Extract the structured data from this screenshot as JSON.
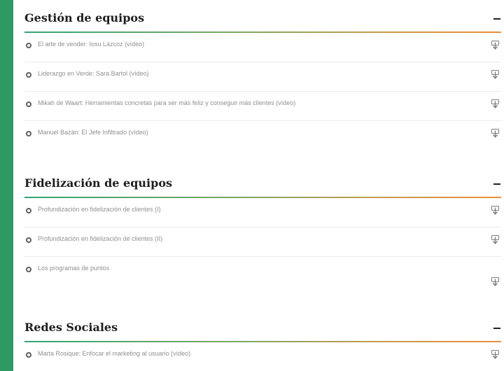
{
  "sections": [
    {
      "title": "Gestión de equipos",
      "lessons": [
        "El arte de vender: Iosu Lázcoz (vídeo)",
        "Liderazgo en Verde: Sara Bartol (vídeo)",
        "Mikah de Waart: Herramientas concretas para ser más feliz y conseguir más clientes (vídeo)",
        "Manuel Bazán: El Jefe Infiltrado (vídeo)"
      ]
    },
    {
      "title": "Fidelización de equipos",
      "lessons": [
        "Profundización en fidelización de clientes (I)",
        "Profundización en fidelización de clientes (II)",
        "Los programas de puntos"
      ]
    },
    {
      "title": "Redes Sociales",
      "lessons": [
        "Marta Rosique: Enfocar el marketing al usuario (vídeo)"
      ]
    }
  ],
  "icons": {
    "lesson_marker": "circle-outline-icon",
    "lesson_action": "download-icon",
    "section_toggle": "minus-icon"
  },
  "colors": {
    "frame_background": "#2e9a63",
    "divider_start": "#33a574",
    "divider_end": "#ec8e37",
    "lesson_text": "#8f8f8f"
  }
}
